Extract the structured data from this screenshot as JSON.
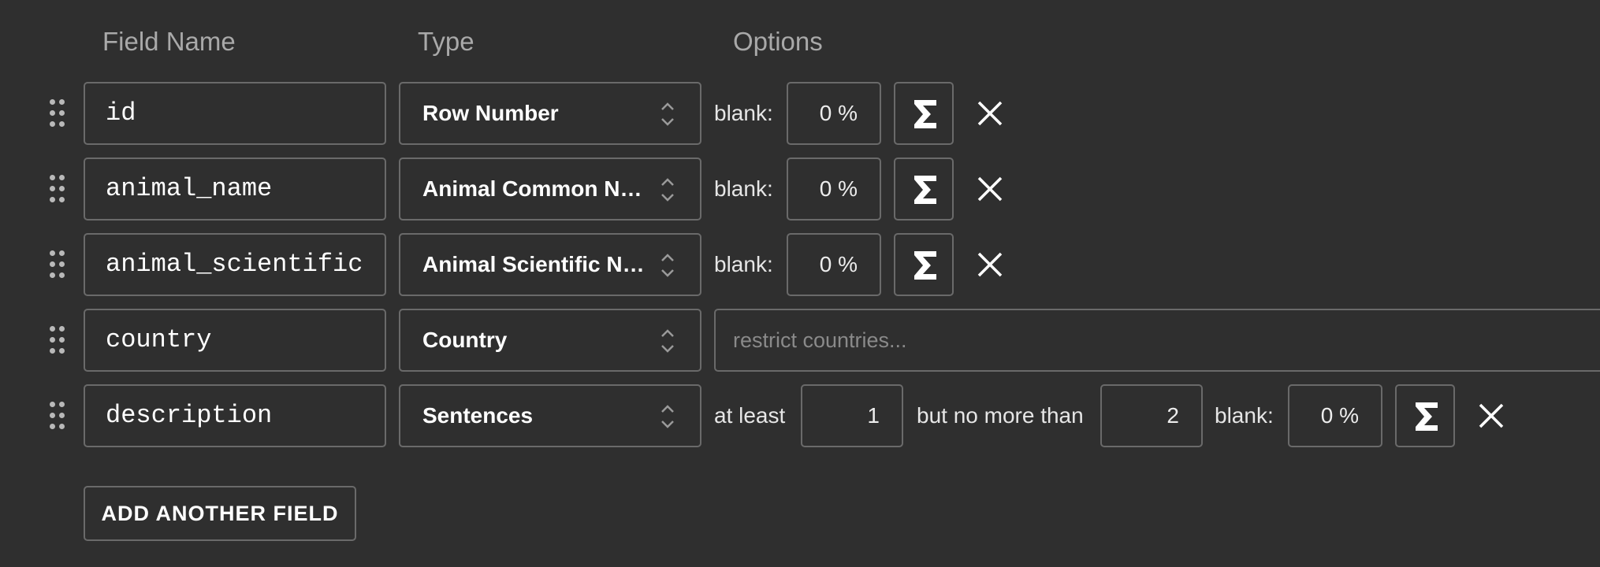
{
  "headers": {
    "field_name": "Field Name",
    "type": "Type",
    "options": "Options"
  },
  "rows": [
    {
      "name": "id",
      "type": "Row Number",
      "blank_label": "blank:",
      "blank_value": "0 %"
    },
    {
      "name": "animal_name",
      "type": "Animal Common Name",
      "blank_label": "blank:",
      "blank_value": "0 %"
    },
    {
      "name": "animal_scientific",
      "type": "Animal Scientific Name",
      "blank_label": "blank:",
      "blank_value": "0 %"
    },
    {
      "name": "country",
      "type": "Country",
      "restrict_placeholder": "restrict countries..."
    },
    {
      "name": "description",
      "type": "Sentences",
      "at_least_label": "at least",
      "at_least_value": "1",
      "no_more_label": "but no more than",
      "no_more_value": "2",
      "blank_label": "blank:",
      "blank_value": "0 %"
    }
  ],
  "icons": {
    "drag": "drag-handle-icon",
    "type_chevron": "chevron-up-down-icon",
    "formula": "sigma-icon",
    "remove": "close-icon"
  },
  "add_button": "ADD ANOTHER FIELD"
}
